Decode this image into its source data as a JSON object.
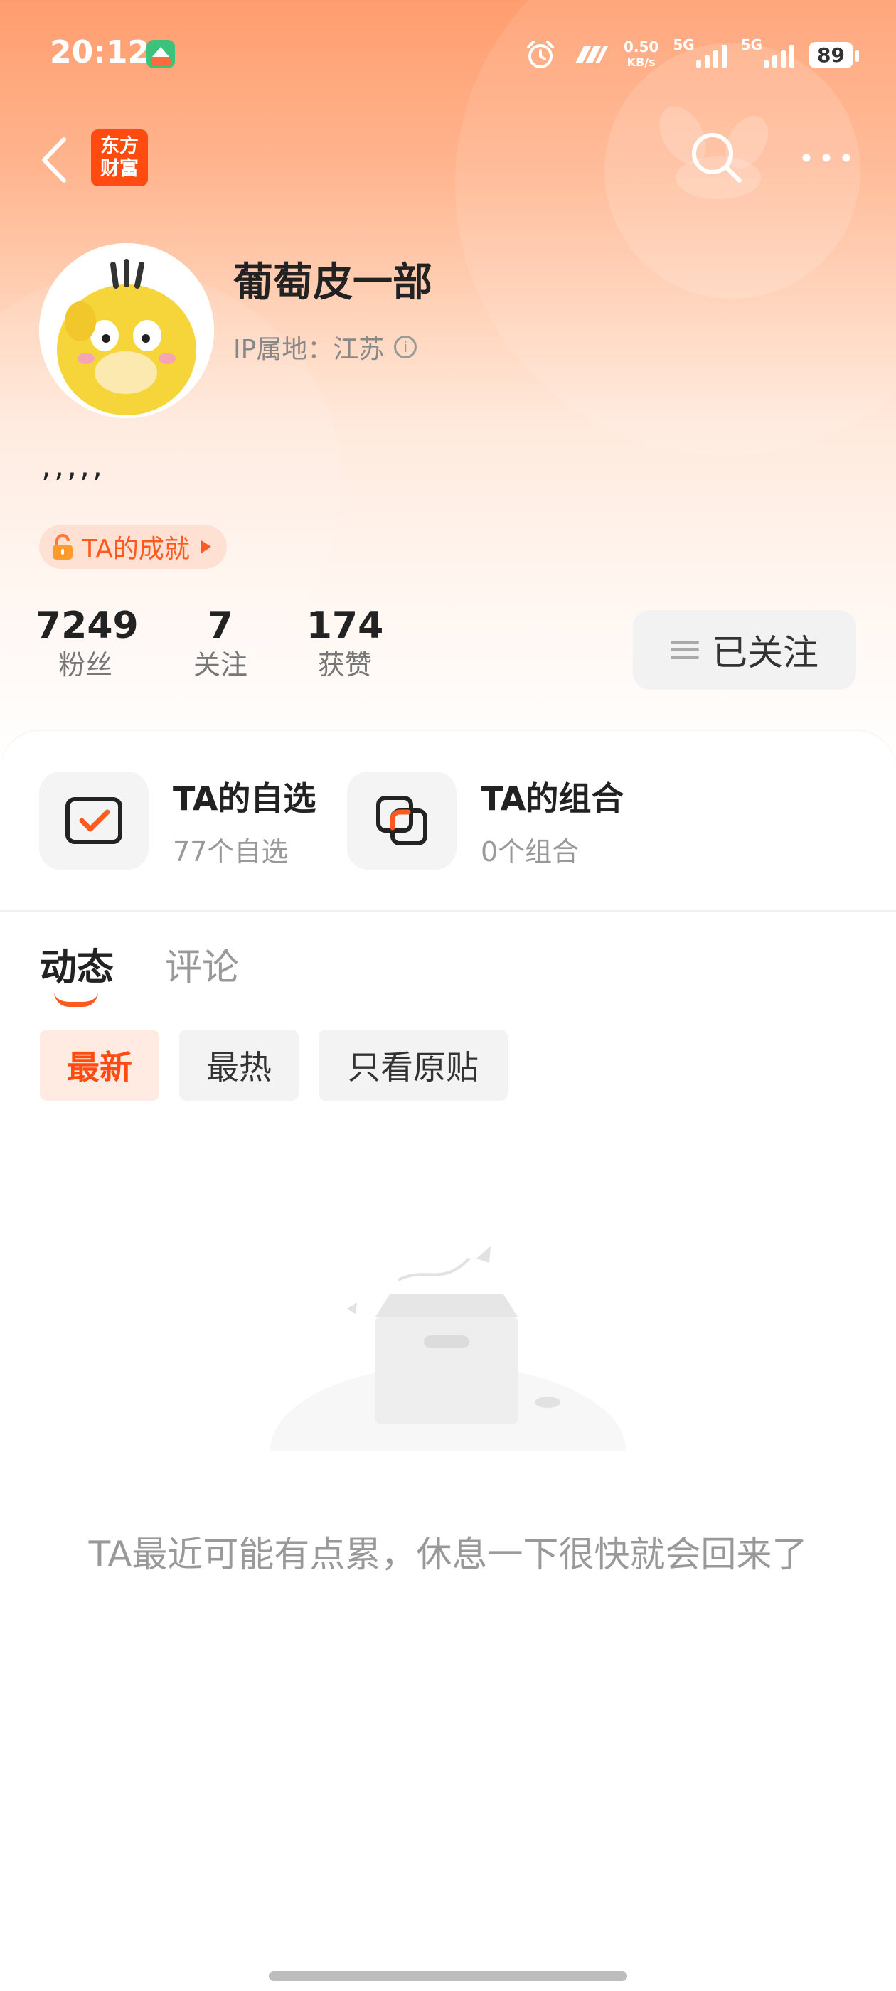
{
  "status_bar": {
    "time": "20:12",
    "net_speed": "0.50",
    "net_unit": "KB/s",
    "signal1": "5G",
    "signal2": "5G",
    "battery": "89"
  },
  "header": {
    "logo_line1": "东方",
    "logo_line2": "财富"
  },
  "profile": {
    "username": "葡萄皮一部",
    "ip_location": "IP属地：江苏",
    "bio": ",,,,,",
    "achievement_label": "TA的成就"
  },
  "stats": [
    {
      "value": "7249",
      "label": "粉丝"
    },
    {
      "value": "7",
      "label": "关注"
    },
    {
      "value": "174",
      "label": "获赞"
    }
  ],
  "follow_button": {
    "label": "已关注"
  },
  "tiles": [
    {
      "title": "TA的自选",
      "subtitle": "77个自选"
    },
    {
      "title": "TA的组合",
      "subtitle": "0个组合"
    }
  ],
  "tabs": [
    {
      "label": "动态",
      "active": true
    },
    {
      "label": "评论",
      "active": false
    }
  ],
  "filters": [
    {
      "label": "最新",
      "active": true
    },
    {
      "label": "最热",
      "active": false
    },
    {
      "label": "只看原贴",
      "active": false
    }
  ],
  "empty_state": {
    "message": "TA最近可能有点累，休息一下很快就会回来了"
  },
  "colors": {
    "accent": "#ff5a1e",
    "hero_top": "#ff9d6e"
  }
}
